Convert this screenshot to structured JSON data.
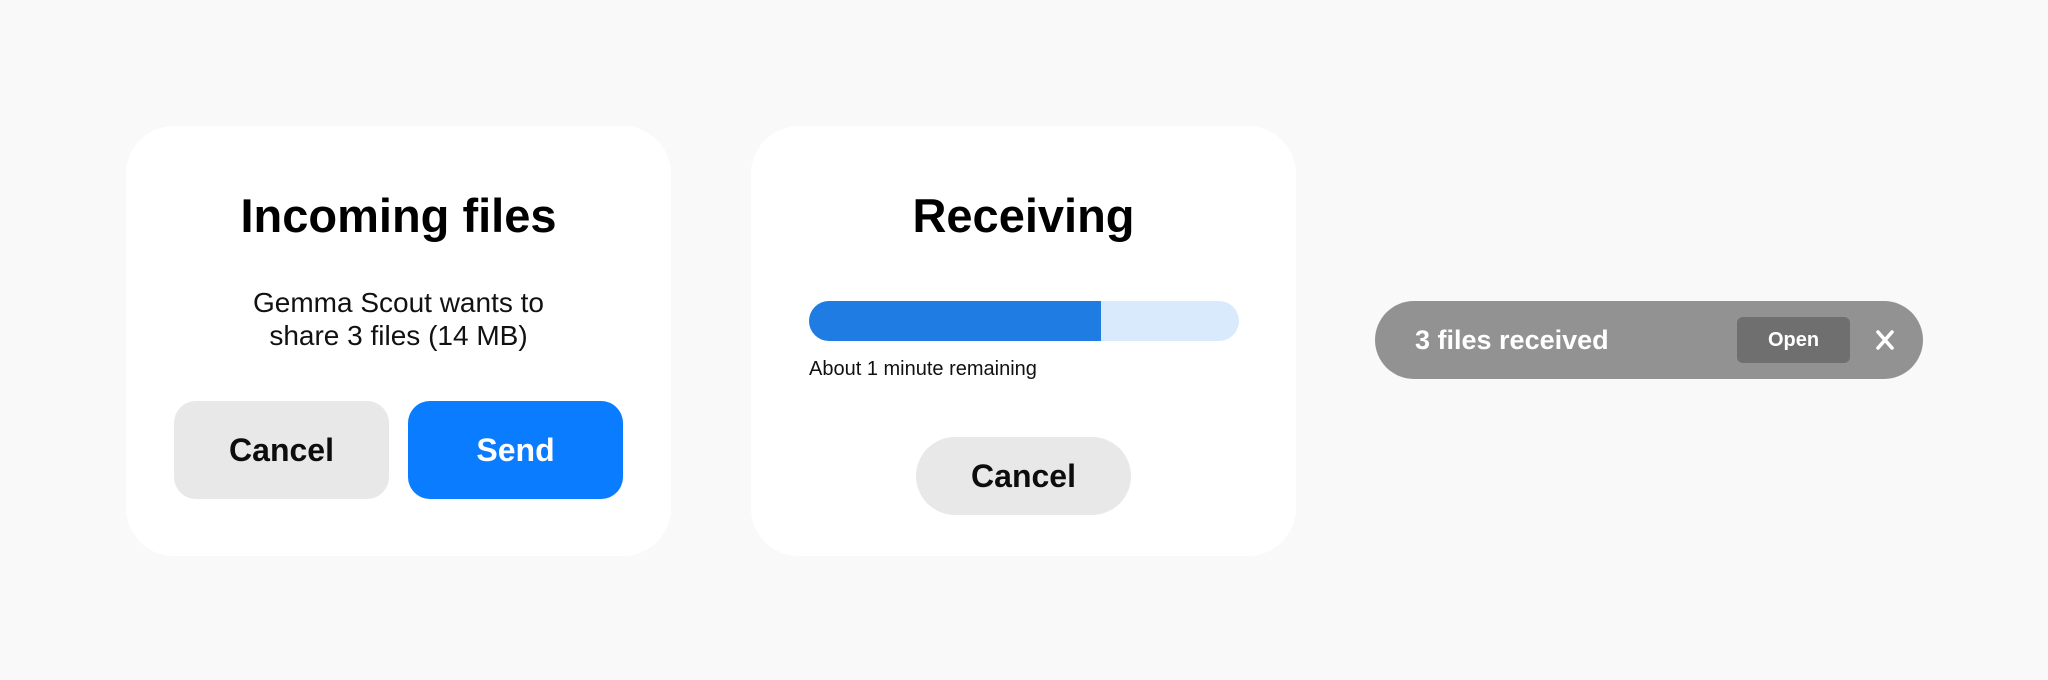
{
  "colors": {
    "primary": "#0a7cff",
    "progress_fill": "#1f7ce3",
    "progress_track": "#d9eafc",
    "toast_bg": "#929292",
    "toast_button_bg": "#6f6f6f"
  },
  "incoming": {
    "title": "Incoming files",
    "message_line1": "Gemma Scout wants to",
    "message_line2": "share 3 files (14 MB)",
    "cancel_label": "Cancel",
    "send_label": "Send"
  },
  "receiving": {
    "title": "Receiving",
    "progress_fraction": 0.68,
    "status": "About 1 minute remaining",
    "cancel_label": "Cancel"
  },
  "toast": {
    "message": "3 files received",
    "open_label": "Open",
    "close_icon": "close-icon"
  }
}
